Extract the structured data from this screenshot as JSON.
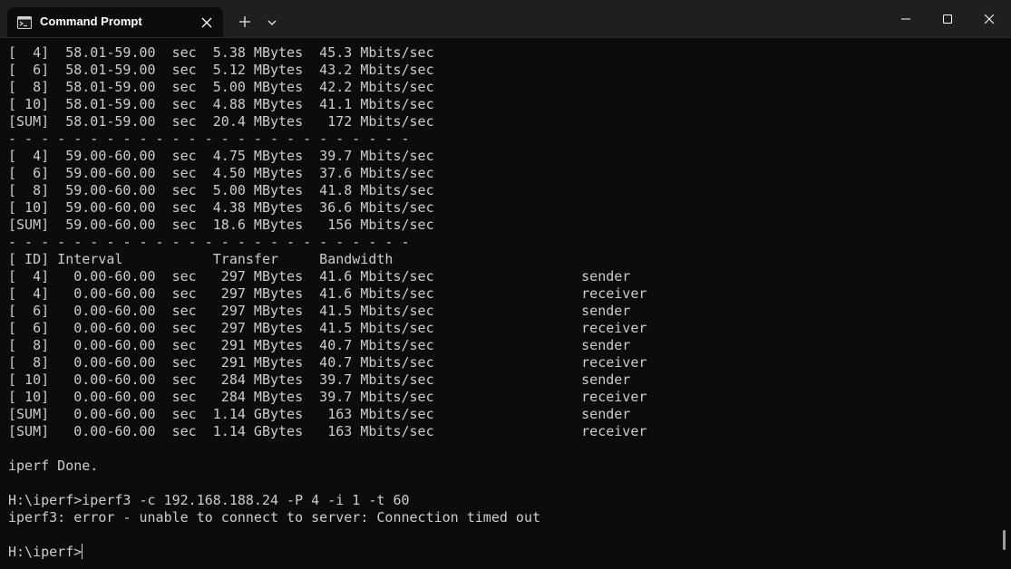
{
  "window": {
    "tab_title": "Command Prompt",
    "icons": {
      "tab": "command-prompt-icon",
      "tab_close": "close-icon",
      "new_tab": "plus-icon",
      "dropdown": "chevron-down-icon",
      "minimize": "minimize-icon",
      "maximize": "maximize-icon",
      "close": "close-icon"
    }
  },
  "colors": {
    "background": "#0c0c0c",
    "titlebar": "#1f1f1f",
    "text": "#cccccc"
  },
  "terminal": {
    "lines": [
      "[  4]  58.01-59.00  sec  5.38 MBytes  45.3 Mbits/sec",
      "[  6]  58.01-59.00  sec  5.12 MBytes  43.2 Mbits/sec",
      "[  8]  58.01-59.00  sec  5.00 MBytes  42.2 Mbits/sec",
      "[ 10]  58.01-59.00  sec  4.88 MBytes  41.1 Mbits/sec",
      "[SUM]  58.01-59.00  sec  20.4 MBytes   172 Mbits/sec",
      "- - - - - - - - - - - - - - - - - - - - - - - - -",
      "[  4]  59.00-60.00  sec  4.75 MBytes  39.7 Mbits/sec",
      "[  6]  59.00-60.00  sec  4.50 MBytes  37.6 Mbits/sec",
      "[  8]  59.00-60.00  sec  5.00 MBytes  41.8 Mbits/sec",
      "[ 10]  59.00-60.00  sec  4.38 MBytes  36.6 Mbits/sec",
      "[SUM]  59.00-60.00  sec  18.6 MBytes   156 Mbits/sec",
      "- - - - - - - - - - - - - - - - - - - - - - - - -",
      "[ ID] Interval           Transfer     Bandwidth",
      "[  4]   0.00-60.00  sec   297 MBytes  41.6 Mbits/sec                  sender",
      "[  4]   0.00-60.00  sec   297 MBytes  41.6 Mbits/sec                  receiver",
      "[  6]   0.00-60.00  sec   297 MBytes  41.5 Mbits/sec                  sender",
      "[  6]   0.00-60.00  sec   297 MBytes  41.5 Mbits/sec                  receiver",
      "[  8]   0.00-60.00  sec   291 MBytes  40.7 Mbits/sec                  sender",
      "[  8]   0.00-60.00  sec   291 MBytes  40.7 Mbits/sec                  receiver",
      "[ 10]   0.00-60.00  sec   284 MBytes  39.7 Mbits/sec                  sender",
      "[ 10]   0.00-60.00  sec   284 MBytes  39.7 Mbits/sec                  receiver",
      "[SUM]   0.00-60.00  sec  1.14 GBytes   163 Mbits/sec                  sender",
      "[SUM]   0.00-60.00  sec  1.14 GBytes   163 Mbits/sec                  receiver",
      "",
      "iperf Done.",
      "",
      "H:\\iperf>iperf3 -c 192.168.188.24 -P 4 -i 1 -t 60",
      "iperf3: error - unable to connect to server: Connection timed out",
      ""
    ],
    "prompt": "H:\\iperf>"
  }
}
